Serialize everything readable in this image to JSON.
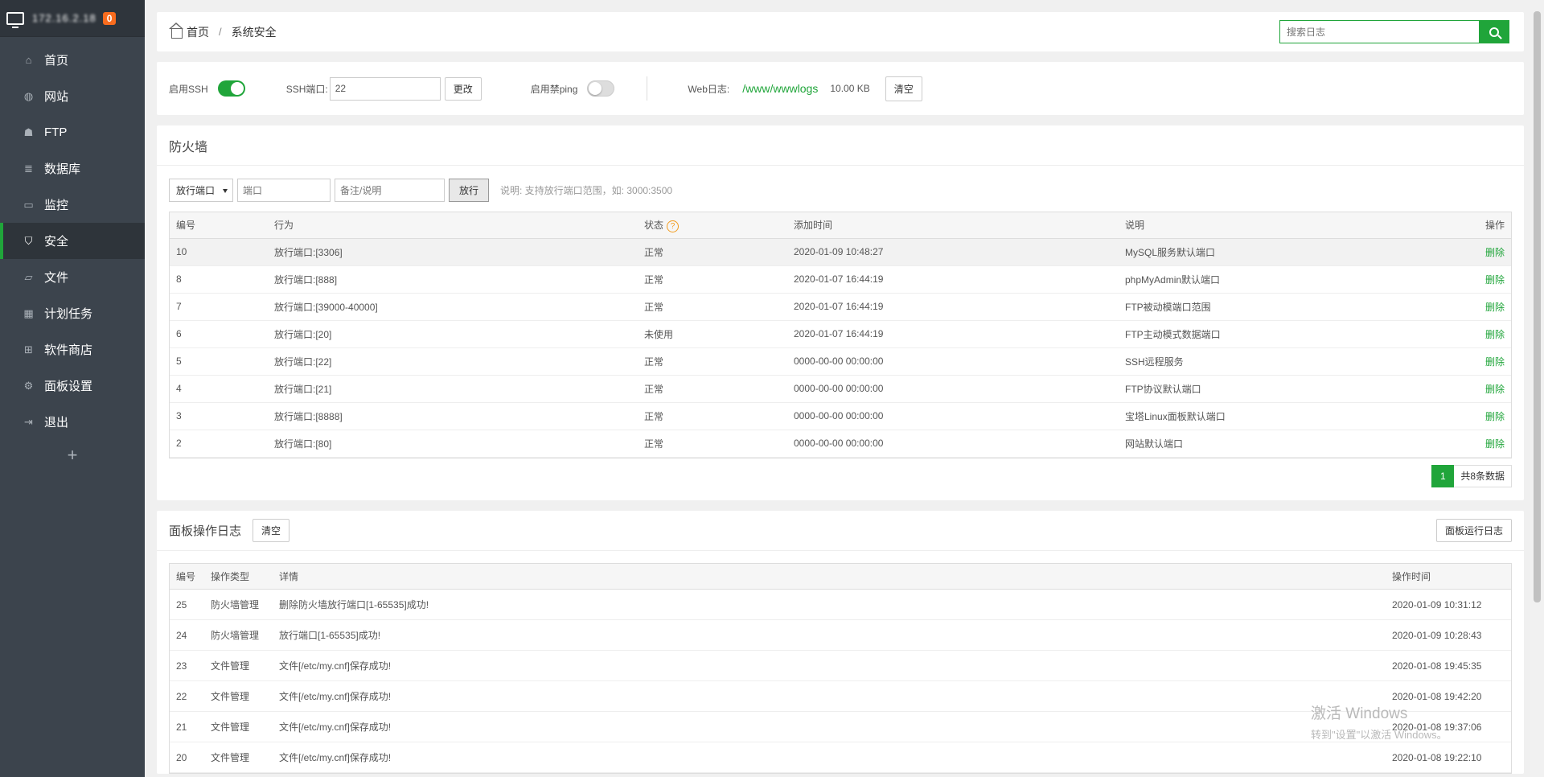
{
  "sidebar": {
    "server_ip": "172.16.2.18",
    "badge": "0",
    "items": [
      {
        "label": "首页",
        "icon": "home-icon"
      },
      {
        "label": "网站",
        "icon": "globe-icon"
      },
      {
        "label": "FTP",
        "icon": "ftp-icon"
      },
      {
        "label": "数据库",
        "icon": "database-icon"
      },
      {
        "label": "监控",
        "icon": "monitor-icon"
      },
      {
        "label": "安全",
        "icon": "shield-icon"
      },
      {
        "label": "文件",
        "icon": "folder-icon"
      },
      {
        "label": "计划任务",
        "icon": "calendar-icon"
      },
      {
        "label": "软件商店",
        "icon": "grid-icon"
      },
      {
        "label": "面板设置",
        "icon": "gear-icon"
      },
      {
        "label": "退出",
        "icon": "logout-icon"
      }
    ],
    "add": "+"
  },
  "breadcrumb": {
    "home": "首页",
    "sep": "/",
    "current": "系统安全"
  },
  "search": {
    "placeholder": "搜索日志"
  },
  "settings": {
    "ssh_label": "启用SSH",
    "ssh_enabled": true,
    "port_label": "SSH端口:",
    "port_value": "22",
    "change_btn": "更改",
    "ping_label": "启用禁ping",
    "ping_enabled": false,
    "weblog_label": "Web日志:",
    "weblog_path": "/www/wwwlogs",
    "weblog_size": "10.00 KB",
    "clear_btn": "清空"
  },
  "firewall": {
    "title": "防火墙",
    "select_value": "放行端口",
    "port_placeholder": "端口",
    "note_placeholder": "备注/说明",
    "allow_btn": "放行",
    "hint": "说明: 支持放行端口范围，如: 3000:3500",
    "headers": [
      "编号",
      "行为",
      "状态",
      "添加时间",
      "说明",
      "操作"
    ],
    "rows": [
      [
        "10",
        "放行端口:[3306]",
        "正常",
        "2020-01-09 10:48:27",
        "MySQL服务默认端口",
        "删除"
      ],
      [
        "8",
        "放行端口:[888]",
        "正常",
        "2020-01-07 16:44:19",
        "phpMyAdmin默认端口",
        "删除"
      ],
      [
        "7",
        "放行端口:[39000-40000]",
        "正常",
        "2020-01-07 16:44:19",
        "FTP被动模端口范围",
        "删除"
      ],
      [
        "6",
        "放行端口:[20]",
        "未使用",
        "2020-01-07 16:44:19",
        "FTP主动模式数据端口",
        "删除"
      ],
      [
        "5",
        "放行端口:[22]",
        "正常",
        "0000-00-00 00:00:00",
        "SSH远程服务",
        "删除"
      ],
      [
        "4",
        "放行端口:[21]",
        "正常",
        "0000-00-00 00:00:00",
        "FTP协议默认端口",
        "删除"
      ],
      [
        "3",
        "放行端口:[8888]",
        "正常",
        "0000-00-00 00:00:00",
        "宝塔Linux面板默认端口",
        "删除"
      ],
      [
        "2",
        "放行端口:[80]",
        "正常",
        "0000-00-00 00:00:00",
        "网站默认端口",
        "删除"
      ]
    ],
    "page": "1",
    "total": "共8条数据"
  },
  "oplog": {
    "title": "面板操作日志",
    "clear_btn": "清空",
    "run_log_btn": "面板运行日志",
    "headers": [
      "编号",
      "操作类型",
      "详情",
      "操作时间"
    ],
    "rows": [
      [
        "25",
        "防火墙管理",
        "删除防火墙放行端口[1-65535]成功!",
        "2020-01-09 10:31:12"
      ],
      [
        "24",
        "防火墙管理",
        "放行端口[1-65535]成功!",
        "2020-01-09 10:28:43"
      ],
      [
        "23",
        "文件管理",
        "文件[/etc/my.cnf]保存成功!",
        "2020-01-08 19:45:35"
      ],
      [
        "22",
        "文件管理",
        "文件[/etc/my.cnf]保存成功!",
        "2020-01-08 19:42:20"
      ],
      [
        "21",
        "文件管理",
        "文件[/etc/my.cnf]保存成功!",
        "2020-01-08 19:37:06"
      ],
      [
        "20",
        "文件管理",
        "文件[/etc/my.cnf]保存成功!",
        "2020-01-08 19:22:10"
      ]
    ]
  },
  "watermark": {
    "line1": "激活 Windows",
    "line2": "转到\"设置\"以激活 Windows。"
  },
  "colors": {
    "accent": "#20a53a",
    "sidebar_bg": "#3c444d",
    "badge": "#f96c1e"
  }
}
